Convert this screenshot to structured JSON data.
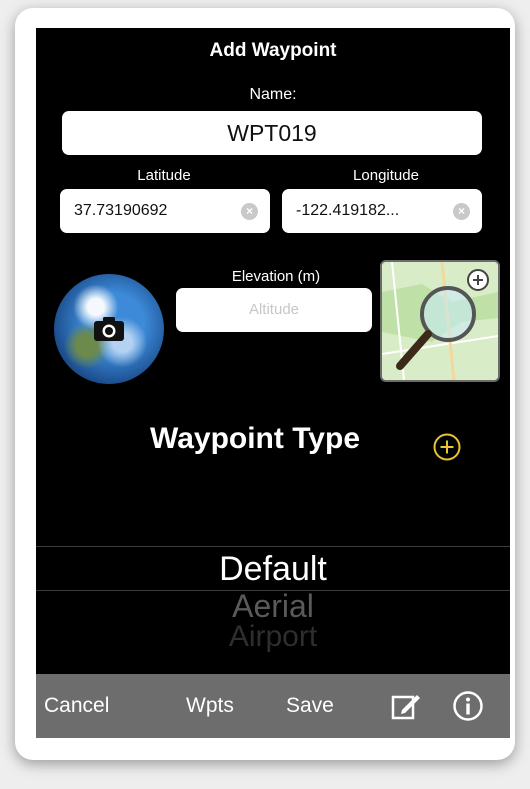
{
  "header": {
    "title": "Add Waypoint"
  },
  "name": {
    "label": "Name:",
    "value": "WPT019"
  },
  "latitude": {
    "label": "Latitude",
    "value": "37.73190692",
    "clear_icon": "clear-icon"
  },
  "longitude": {
    "label": "Longitude",
    "value": "-122.419182...",
    "clear_icon": "clear-icon"
  },
  "elevation": {
    "label": "Elevation (m)",
    "placeholder": "Altitude"
  },
  "photo": {
    "icon": "camera-icon"
  },
  "map": {
    "icon": "magnifier-add-icon"
  },
  "waypoint_type": {
    "label": "Waypoint Type",
    "add_icon": "plus-circle-icon",
    "options": [
      "Default",
      "Aerial",
      "Airport"
    ],
    "selected": "Default"
  },
  "toolbar": {
    "cancel": "Cancel",
    "wpts": "Wpts",
    "save": "Save",
    "edit_icon": "edit-icon",
    "info_icon": "info-icon"
  },
  "colors": {
    "accent": "#e8c531",
    "background": "#000000",
    "toolbar": "#6d6d6d"
  }
}
